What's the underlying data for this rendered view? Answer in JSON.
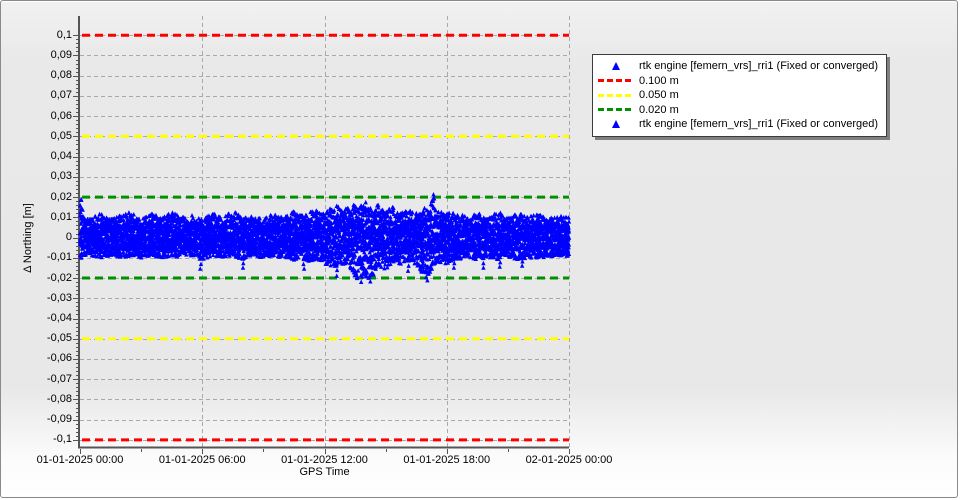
{
  "chart_data": {
    "type": "scatter",
    "title": "",
    "xlabel": "GPS Time",
    "ylabel": "Δ Northing [m]",
    "xlim_hours": [
      0,
      24
    ],
    "ylim": [
      -0.1035,
      0.1095
    ],
    "grid": "dashed",
    "x_ticks": [
      {
        "hour": 0,
        "label": "01-01-2025 00:00"
      },
      {
        "hour": 6,
        "label": "01-01-2025 06:00"
      },
      {
        "hour": 12,
        "label": "01-01-2025 12:00"
      },
      {
        "hour": 18,
        "label": "01-01-2025 18:00"
      },
      {
        "hour": 24,
        "label": "02-01-2025 00:00"
      }
    ],
    "x_minor_tick_hours": [
      3,
      9,
      15,
      21
    ],
    "y_ticks": [
      {
        "value": 0.1,
        "label": "0,1"
      },
      {
        "value": 0.09,
        "label": "0,09"
      },
      {
        "value": 0.08,
        "label": "0,08"
      },
      {
        "value": 0.07,
        "label": "0,07"
      },
      {
        "value": 0.06,
        "label": "0,06"
      },
      {
        "value": 0.05,
        "label": "0,05"
      },
      {
        "value": 0.04,
        "label": "0,04"
      },
      {
        "value": 0.03,
        "label": "0,03"
      },
      {
        "value": 0.02,
        "label": "0,02"
      },
      {
        "value": 0.01,
        "label": "0,01"
      },
      {
        "value": 0.0,
        "label": "0"
      },
      {
        "value": -0.01,
        "label": "-0,01"
      },
      {
        "value": -0.02,
        "label": "-0,02"
      },
      {
        "value": -0.03,
        "label": "-0,03"
      },
      {
        "value": -0.04,
        "label": "-0,04"
      },
      {
        "value": -0.05,
        "label": "-0,05"
      },
      {
        "value": -0.06,
        "label": "-0,06"
      },
      {
        "value": -0.07,
        "label": "-0,07"
      },
      {
        "value": -0.08,
        "label": "-0,08"
      },
      {
        "value": -0.09,
        "label": "-0,09"
      },
      {
        "value": -0.1,
        "label": "-0,1"
      }
    ],
    "thresholds": [
      {
        "label": "0.100 m",
        "value": 0.1,
        "mirrored": true,
        "color": "#ff0000"
      },
      {
        "label": "0.050 m",
        "value": 0.05,
        "mirrored": true,
        "color": "#ffff00"
      },
      {
        "label": "0.020 m",
        "value": 0.02,
        "mirrored": true,
        "color": "#009000"
      }
    ],
    "series": [
      {
        "name": "rtk engine [femern_vrs]_rri1 (Fixed or converged)",
        "marker": "triangle",
        "color": "#0000ff",
        "envelope": {
          "hours": [
            0,
            0.06,
            0.18,
            0.5,
            1,
            1.5,
            2,
            2.5,
            3,
            3.5,
            4,
            4.5,
            5,
            5.5,
            6,
            6.5,
            7,
            7.5,
            8,
            8.5,
            9,
            9.5,
            10,
            10.5,
            11,
            11.5,
            12,
            12.5,
            13,
            13.3,
            13.6,
            14,
            14.3,
            14.6,
            15,
            15.3,
            15.6,
            16,
            16.5,
            17,
            17.2,
            17.35,
            17.5,
            18,
            18.5,
            19,
            19.5,
            20,
            20.5,
            21,
            21.5,
            22,
            22.5,
            23,
            23.5,
            24
          ],
          "hi": [
            0.021,
            0.021,
            0.01,
            0.009,
            0.012,
            0.009,
            0.011,
            0.013,
            0.009,
            0.012,
            0.01,
            0.013,
            0.01,
            0.011,
            0.009,
            0.012,
            0.01,
            0.013,
            0.01,
            0.011,
            0.009,
            0.012,
            0.01,
            0.013,
            0.011,
            0.014,
            0.012,
            0.016,
            0.014,
            0.018,
            0.015,
            0.018,
            0.014,
            0.017,
            0.013,
            0.016,
            0.012,
            0.014,
            0.012,
            0.015,
            0.019,
            0.021,
            0.013,
            0.012,
            0.013,
            0.01,
            0.012,
            0.01,
            0.013,
            0.01,
            0.012,
            0.01,
            0.012,
            0.01,
            0.011,
            0.01
          ],
          "lo": [
            -0.013,
            -0.013,
            -0.009,
            -0.009,
            -0.01,
            -0.009,
            -0.01,
            -0.009,
            -0.01,
            -0.009,
            -0.01,
            -0.009,
            -0.01,
            -0.009,
            -0.011,
            -0.009,
            -0.01,
            -0.009,
            -0.011,
            -0.009,
            -0.01,
            -0.009,
            -0.01,
            -0.011,
            -0.012,
            -0.011,
            -0.013,
            -0.015,
            -0.014,
            -0.016,
            -0.021,
            -0.019,
            -0.021,
            -0.015,
            -0.016,
            -0.013,
            -0.014,
            -0.012,
            -0.013,
            -0.021,
            -0.017,
            -0.015,
            -0.012,
            -0.013,
            -0.011,
            -0.01,
            -0.011,
            -0.01,
            -0.011,
            -0.01,
            -0.011,
            -0.01,
            -0.01,
            -0.01,
            -0.01,
            -0.009
          ]
        },
        "extra_points": [
          [
            0.04,
            0.0185
          ],
          [
            5.9,
            -0.0155
          ],
          [
            8.0,
            -0.015
          ],
          [
            11.0,
            -0.0155
          ],
          [
            12.6,
            -0.019
          ],
          [
            13.8,
            -0.022
          ],
          [
            14.25,
            -0.0218
          ],
          [
            16.1,
            -0.0165
          ],
          [
            17.05,
            -0.0212
          ],
          [
            17.35,
            0.0212
          ],
          [
            18.35,
            -0.015
          ],
          [
            19.8,
            -0.015
          ],
          [
            20.6,
            -0.0145
          ],
          [
            21.7,
            -0.014
          ]
        ]
      }
    ],
    "legend": {
      "position": "right",
      "entries": [
        {
          "type": "marker",
          "color": "#0000ff",
          "label": "rtk engine [femern_vrs]_rri1 (Fixed or converged)"
        },
        {
          "type": "dash",
          "color": "#ff0000",
          "label": "0.100 m"
        },
        {
          "type": "dash",
          "color": "#ffff00",
          "label": "0.050 m"
        },
        {
          "type": "dash",
          "color": "#009000",
          "label": "0.020 m"
        },
        {
          "type": "marker",
          "color": "#0000ff",
          "label": "rtk engine [femern_vrs]_rri1 (Fixed or converged)"
        }
      ]
    },
    "colors": {
      "plot_background": "#e8e8e8",
      "grid": "#a9a9a9",
      "axis": "#555555"
    }
  }
}
